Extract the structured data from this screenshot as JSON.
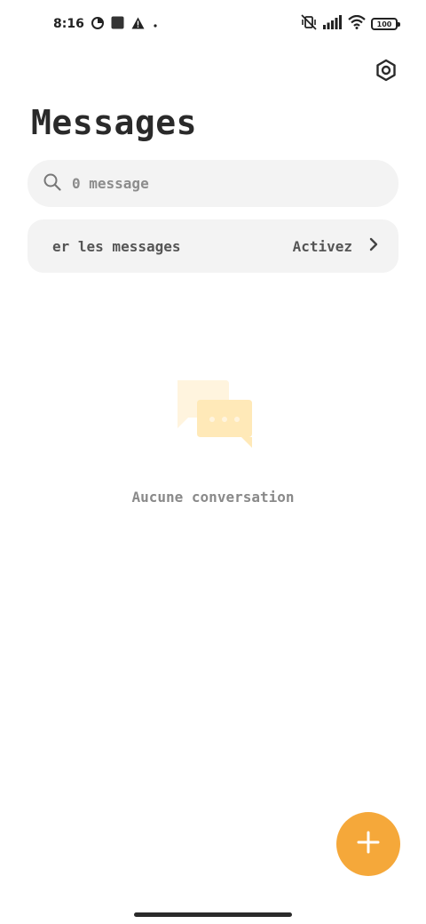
{
  "status_bar": {
    "time": "8:16",
    "battery": "100",
    "icons": [
      "data-saver-icon",
      "square-notification-icon",
      "warning-icon",
      "dot-icon",
      "mute-vibrate-icon",
      "signal-icon",
      "wifi-icon",
      "battery-icon"
    ]
  },
  "header": {
    "title": "Messages",
    "settings_icon": "settings-hexagon-icon"
  },
  "search": {
    "placeholder": "0 message",
    "icon": "search-icon"
  },
  "notification_row": {
    "label": "er les messages",
    "action": "Activez",
    "icon": "chevron-right-icon"
  },
  "empty_state": {
    "icon": "chat-bubbles-icon",
    "text": "Aucune conversation"
  },
  "fab": {
    "icon": "plus-icon"
  },
  "colors": {
    "accent": "#f5a83a",
    "surface": "#f3f3f3",
    "title": "#2a2a2a",
    "muted": "#8a8a8a",
    "illustration_light": "#fff4de",
    "illustration": "#ffe9b8"
  }
}
